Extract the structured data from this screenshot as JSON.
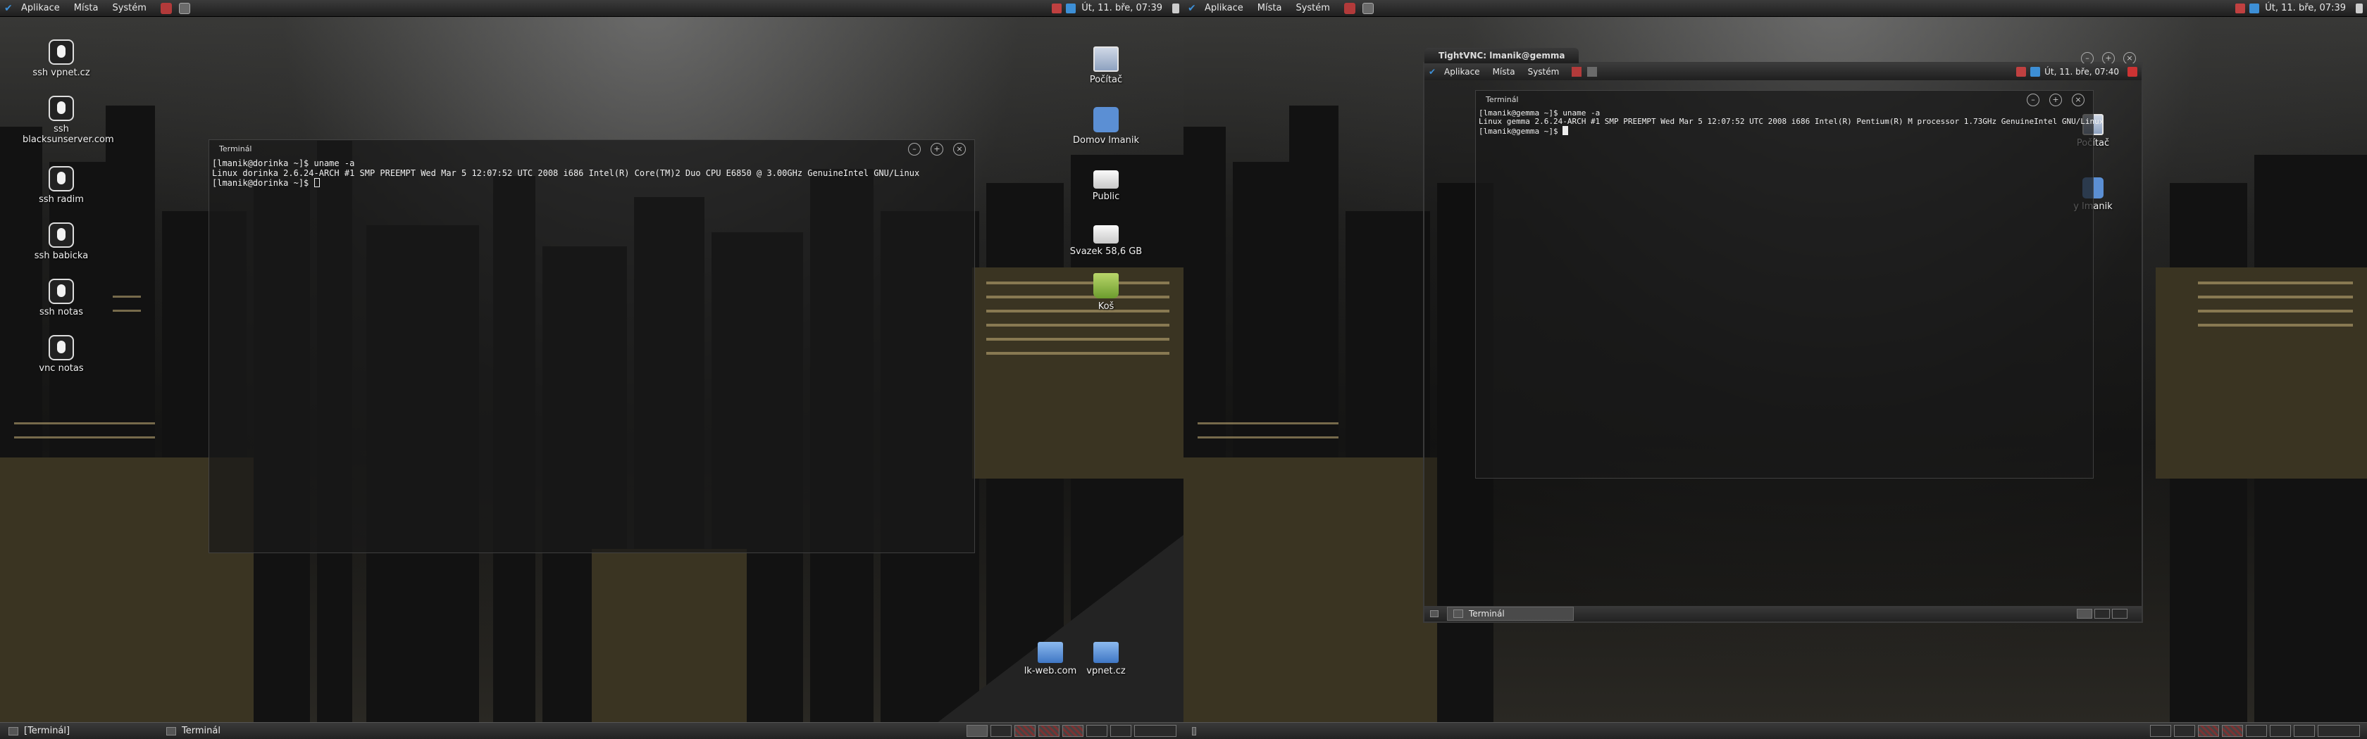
{
  "left": {
    "panel": {
      "menus": [
        "Aplikace",
        "Místa",
        "Systém"
      ],
      "clock": "Út, 11. bře, 07:39"
    },
    "desktop_icons": [
      {
        "label": "ssh vpnet.cz",
        "icon": "tux-icon"
      },
      {
        "label": "ssh blacksunserver.com",
        "icon": "tux-icon"
      },
      {
        "label": "ssh radim",
        "icon": "tux-icon"
      },
      {
        "label": "ssh babicka",
        "icon": "tux-icon"
      },
      {
        "label": "ssh notas",
        "icon": "tux-icon"
      },
      {
        "label": "vnc notas",
        "icon": "tux-icon"
      }
    ],
    "right_icons": [
      {
        "label": "Počítač",
        "icon": "computer-icon"
      },
      {
        "label": "Domov lmanik",
        "icon": "home-folder-icon"
      },
      {
        "label": "Public",
        "icon": "drive-icon"
      },
      {
        "label": "Svazek 58,6 GB",
        "icon": "drive-icon"
      },
      {
        "label": "Koš",
        "icon": "trash-icon"
      }
    ],
    "bottom_icons": [
      {
        "label": "lk-web.com",
        "icon": "folder-icon"
      },
      {
        "label": "vpnet.cz",
        "icon": "folder-icon"
      }
    ],
    "terminal": {
      "title": "Terminál",
      "lines": [
        "[lmanik@dorinka ~]$ uname -a",
        "Linux dorinka 2.6.24-ARCH #1 SMP PREEMPT Wed Mar 5 12:07:52 UTC 2008 i686 Intel(R) Core(TM)2 Duo CPU E6850 @ 3.00GHz GenuineIntel GNU/Linux",
        "[lmanik@dorinka ~]$ "
      ]
    },
    "taskbar": {
      "tasks": [
        "[Terminál]",
        "Terminál"
      ]
    }
  },
  "right": {
    "panel": {
      "menus": [
        "Aplikace",
        "Místa",
        "Systém"
      ],
      "clock": "Út, 11. bře, 07:39"
    },
    "vnc": {
      "title": "TightVNC: lmanik@gemma",
      "inner_menus": [
        "Aplikace",
        "Místa",
        "Systém"
      ],
      "inner_clock": "Út, 11. bře, 07:40",
      "inner_icons": [
        "Počítač",
        "y lmanik"
      ],
      "terminal": {
        "title": "Terminál",
        "lines": [
          "[lmanik@gemma ~]$ uname -a",
          "Linux gemma 2.6.24-ARCH #1 SMP PREEMPT Wed Mar 5 12:07:52 UTC 2008 i686 Intel(R) Pentium(R) M processor 1.73GHz GenuineIntel GNU/Linux",
          "[lmanik@gemma ~]$ "
        ]
      },
      "inner_task": "Terminál"
    }
  },
  "colors": {
    "accent": "#3d8fd6",
    "panel": "#2a2a2a"
  }
}
